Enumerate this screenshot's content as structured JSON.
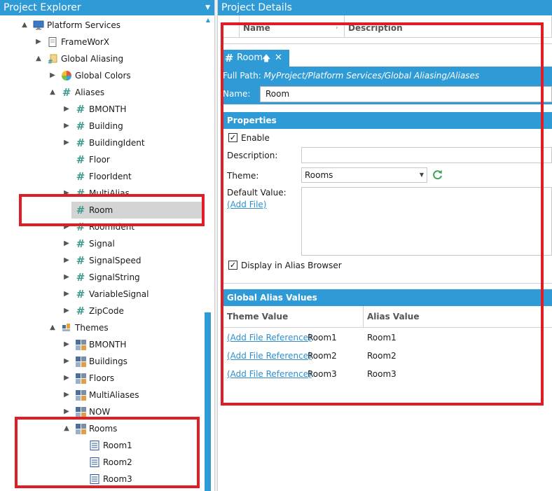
{
  "explorer": {
    "title": "Project Explorer",
    "tree": [
      {
        "label": "Platform Services",
        "icon": "monitor-icon",
        "expander": "▲",
        "selected": false
      },
      {
        "label": "FrameWorX",
        "icon": "document-icon",
        "expander": "▶",
        "selected": false
      },
      {
        "label": "Global Aliasing",
        "icon": "global-aliasing-icon",
        "expander": "▲",
        "selected": false
      },
      {
        "label": "Global Colors",
        "icon": "color-wheel-icon",
        "expander": "▶",
        "selected": false
      },
      {
        "label": "Aliases",
        "icon": "hash-icon",
        "expander": "▲",
        "selected": false
      },
      {
        "label": "BMONTH",
        "icon": "hash-icon",
        "expander": "▶",
        "selected": false
      },
      {
        "label": "Building",
        "icon": "hash-icon",
        "expander": "▶",
        "selected": false
      },
      {
        "label": "BuildingIdent",
        "icon": "hash-icon",
        "expander": "▶",
        "selected": false
      },
      {
        "label": "Floor",
        "icon": "hash-icon",
        "expander": "",
        "selected": false
      },
      {
        "label": "FloorIdent",
        "icon": "hash-icon",
        "expander": "",
        "selected": false
      },
      {
        "label": "MultiAlias",
        "icon": "hash-icon",
        "expander": "▶",
        "selected": false
      },
      {
        "label": "Room",
        "icon": "hash-icon",
        "expander": "",
        "selected": true
      },
      {
        "label": "RoomIdent",
        "icon": "hash-icon",
        "expander": "▶",
        "selected": false
      },
      {
        "label": "Signal",
        "icon": "hash-icon",
        "expander": "▶",
        "selected": false
      },
      {
        "label": "SignalSpeed",
        "icon": "hash-icon",
        "expander": "▶",
        "selected": false
      },
      {
        "label": "SignalString",
        "icon": "hash-icon",
        "expander": "▶",
        "selected": false
      },
      {
        "label": "VariableSignal",
        "icon": "hash-icon",
        "expander": "▶",
        "selected": false
      },
      {
        "label": "ZipCode",
        "icon": "hash-icon",
        "expander": "▶",
        "selected": false
      },
      {
        "label": "Themes",
        "icon": "themes-folder-icon",
        "expander": "▲",
        "selected": false
      },
      {
        "label": "BMONTH",
        "icon": "theme-icon",
        "expander": "▶",
        "selected": false
      },
      {
        "label": "Buildings",
        "icon": "theme-icon",
        "expander": "▶",
        "selected": false
      },
      {
        "label": "Floors",
        "icon": "theme-icon",
        "expander": "▶",
        "selected": false
      },
      {
        "label": "MultiAliases",
        "icon": "theme-icon",
        "expander": "▶",
        "selected": false
      },
      {
        "label": "NOW",
        "icon": "theme-icon",
        "expander": "▶",
        "selected": false
      },
      {
        "label": "Rooms",
        "icon": "theme-icon",
        "expander": "▲",
        "selected": false
      },
      {
        "label": "Room1",
        "icon": "theme-value-icon",
        "expander": "",
        "selected": false
      },
      {
        "label": "Room2",
        "icon": "theme-value-icon",
        "expander": "",
        "selected": false
      },
      {
        "label": "Room3",
        "icon": "theme-value-icon",
        "expander": "",
        "selected": false
      }
    ]
  },
  "details": {
    "title": "Project Details",
    "grid": {
      "col_name": "Name",
      "col_description": "Description"
    },
    "tab": {
      "label": "Room",
      "pin": "🡅",
      "close": "✕"
    },
    "full_path_label": "Full Path:",
    "full_path_value": "MyProject/Platform Services/Global Aliasing/Aliases",
    "name_label": "Name:",
    "name_value": "Room",
    "properties": {
      "header": "Properties",
      "enable_label": "Enable",
      "enable_checked": true,
      "description_label": "Description:",
      "description_value": "",
      "theme_label": "Theme:",
      "theme_value": "Rooms",
      "default_value_label": "Default Value:",
      "add_file_link": "(Add File)",
      "display_label": "Display in Alias Browser",
      "display_checked": true
    },
    "values": {
      "header": "Global Alias Values",
      "col_theme": "Theme Value",
      "col_alias": "Alias Value",
      "rows": [
        {
          "link": "(Add File Reference)",
          "theme": "Room1",
          "alias": "Room1"
        },
        {
          "link": "(Add File Reference)",
          "theme": "Room2",
          "alias": "Room2"
        },
        {
          "link": "(Add File Reference)",
          "theme": "Room3",
          "alias": "Room3"
        }
      ]
    }
  },
  "colors": {
    "accent": "#2e9ad6",
    "highlight": "#e01c24",
    "hash": "#3e9b8d",
    "selection": "#d4d4d4"
  }
}
